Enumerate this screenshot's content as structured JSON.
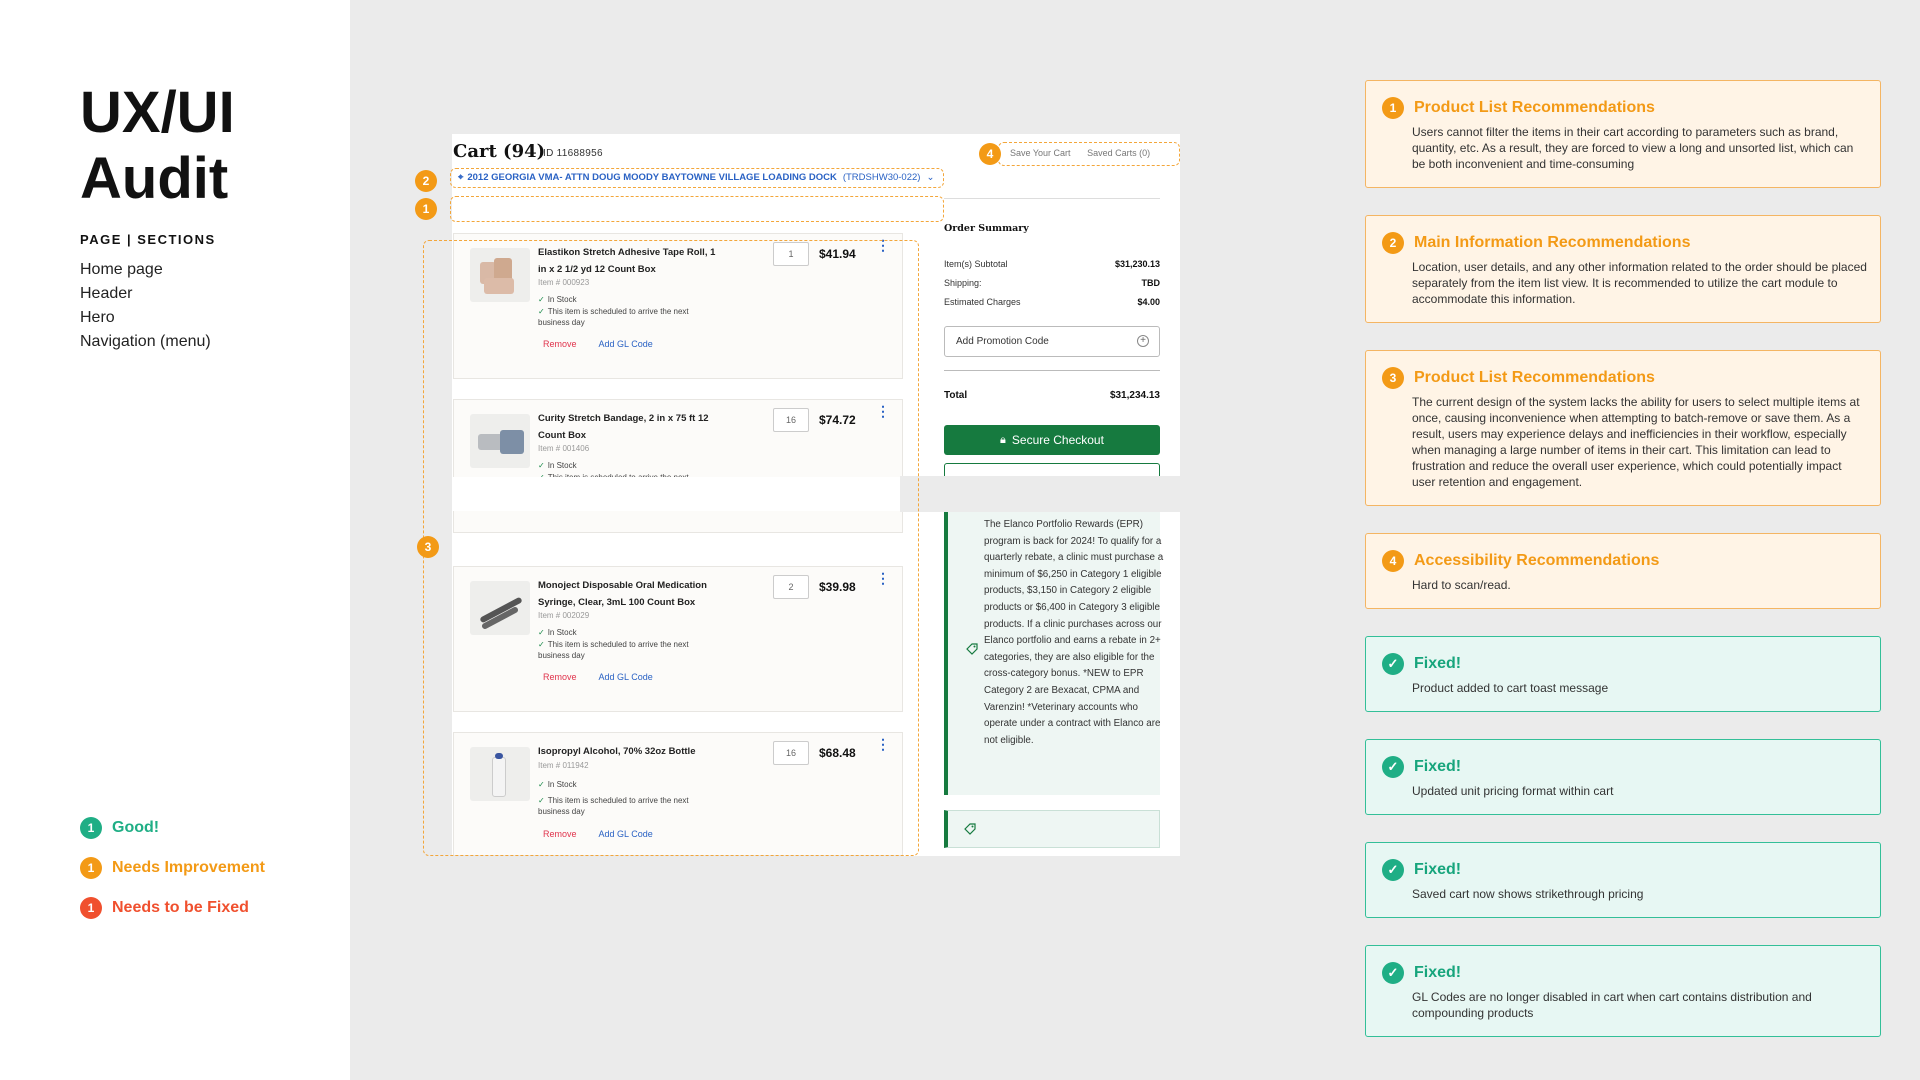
{
  "left": {
    "title_line1": "UX/UI",
    "title_line2": "Audit",
    "sections_heading": "PAGE | SECTIONS",
    "sections": [
      "Home page",
      "Header",
      "Hero",
      "Navigation (menu)"
    ],
    "legend": [
      {
        "num": "1",
        "label": "Good!",
        "color": "#1fae85"
      },
      {
        "num": "1",
        "label": "Needs Improvement",
        "color": "#f39a16"
      },
      {
        "num": "1",
        "label": "Needs to be Fixed",
        "color": "#f0502e"
      }
    ]
  },
  "cart": {
    "title": "Cart (94)",
    "id": "ID 11688956",
    "save_cart": "Save Your Cart",
    "saved_carts": "Saved Carts (0)",
    "address_main": "2012 GEORGIA VMA- ATTN DOUG MOODY  BAYTOWNE VILLAGE LOADING DOCK",
    "address_code": "(TRDSHW30-022)",
    "items": [
      {
        "name": "Elastikon Stretch Adhesive Tape Roll, 1 in x 2 1/2 yd 12 Count Box",
        "item_no": "Item # 000923",
        "qty": "1",
        "price": "$41.94",
        "stock": "In Stock",
        "schedule": "This item is scheduled to arrive the next business day"
      },
      {
        "name": "Curity Stretch Bandage, 2 in x 75 ft 12 Count Box",
        "item_no": "Item # 001406",
        "qty": "16",
        "price": "$74.72",
        "stock": "In Stock",
        "schedule": "This item is scheduled to arrive the next"
      },
      {
        "name": "Monoject Disposable Oral Medication Syringe, Clear, 3mL 100 Count Box",
        "item_no": "Item # 002029",
        "qty": "2",
        "price": "$39.98",
        "stock": "In Stock",
        "schedule": "This item is scheduled to arrive the next business day"
      },
      {
        "name": "Isopropyl Alcohol, 70% 32oz Bottle",
        "item_no": "Item # 011942",
        "qty": "16",
        "price": "$68.48",
        "stock": "In Stock",
        "schedule": "This item is scheduled to arrive the next business day"
      }
    ],
    "remove_label": "Remove",
    "gl_label": "Add GL Code",
    "summary": {
      "title": "Order Summary",
      "rows": [
        {
          "label": "Item(s) Subtotal",
          "value": "$31,230.13"
        },
        {
          "label": "Shipping:",
          "value": "TBD"
        },
        {
          "label": "Estimated Charges",
          "value": "$4.00"
        }
      ],
      "promo_label": "Add Promotion Code",
      "total_label": "Total",
      "total_value": "$31,234.13",
      "checkout_label": "Secure Checkout",
      "rewards_text": "The Elanco Portfolio Rewards (EPR) program is back for 2024! To qualify for a quarterly rebate, a clinic must purchase a minimum of $6,250 in Category 1 eligible products, $3,150 in Category 2 eligible products or $6,400 in Category 3 eligible products. If a clinic purchases across our Elanco portfolio and earns a rebate in 2+ categories, they are also eligible for the cross-category bonus. *NEW to EPR Category 2 are Bexacat, CPMA and Varenzin! *Veterinary accounts who operate under a contract with Elanco are not eligible."
    }
  },
  "annotations": {
    "badge_4": "4",
    "badge_2": "2",
    "badge_1": "1",
    "badge_3": "3"
  },
  "cards": [
    {
      "type": "orange",
      "num": "1",
      "title": "Product List Recommendations",
      "text": "Users cannot filter the items in their cart according to parameters such as brand, quantity, etc. As a result, they are forced to view a long and unsorted list, which can be both inconvenient and time-consuming"
    },
    {
      "type": "orange",
      "num": "2",
      "title": "Main Information Recommendations",
      "text": "Location, user details, and any other information related to the order should be placed separately from the item list view. It is recommended to utilize the cart module to accommodate this information."
    },
    {
      "type": "orange",
      "num": "3",
      "title": "Product List Recommendations",
      "text": "The current design of the system lacks the ability for users to select multiple items at once, causing inconvenience when attempting to batch-remove or save them. As a result, users may experience delays and inefficiencies in their workflow, especially when managing a large number of items in their cart. This limitation can lead to frustration and reduce the overall user experience, which could potentially impact user retention and engagement."
    },
    {
      "type": "orange",
      "num": "4",
      "title": "Accessibility Recommendations",
      "text": "Hard to scan/read."
    },
    {
      "type": "green",
      "title": "Fixed!",
      "text": "Product added to cart toast message"
    },
    {
      "type": "green",
      "title": "Fixed!",
      "text": "Updated unit pricing format within cart"
    },
    {
      "type": "green",
      "title": "Fixed!",
      "text": "Saved cart now shows strikethrough pricing"
    },
    {
      "type": "green",
      "title": "Fixed!",
      "text": "GL Codes are no longer disabled in cart when cart contains distribution and compounding products"
    }
  ],
  "colors": {
    "good": "#1fae85",
    "improve": "#f39a16",
    "fix": "#f0502e",
    "brand_green": "#167a3f",
    "link_blue": "#2a62c4"
  }
}
